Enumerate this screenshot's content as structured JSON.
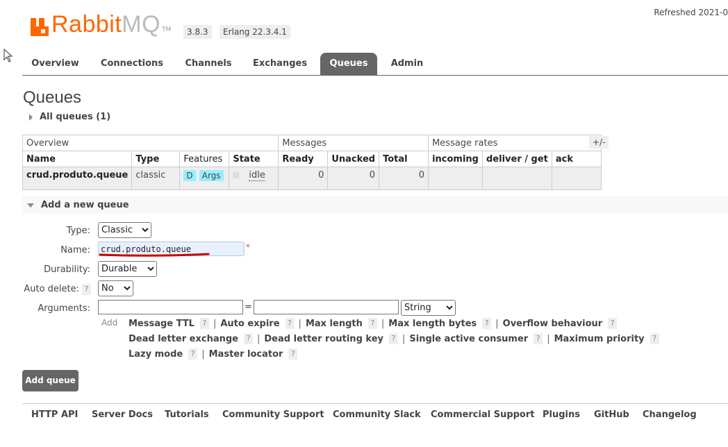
{
  "brand": {
    "name_main": "Rabbit",
    "name_accent": "MQ",
    "tm": "TM"
  },
  "version": "3.8.3",
  "erlang": "Erlang 22.3.4.1",
  "refreshed": "Refreshed 2021-0",
  "tabs": [
    {
      "label": "Overview"
    },
    {
      "label": "Connections"
    },
    {
      "label": "Channels"
    },
    {
      "label": "Exchanges"
    },
    {
      "label": "Queues",
      "active": true
    },
    {
      "label": "Admin"
    }
  ],
  "page_title": "Queues",
  "all_queues_label": "All queues (1)",
  "table": {
    "groups": [
      "Overview",
      "Messages",
      "Message rates"
    ],
    "headers": [
      "Name",
      "Type",
      "Features",
      "State",
      "Ready",
      "Unacked",
      "Total",
      "incoming",
      "deliver / get",
      "ack"
    ],
    "rows": [
      {
        "name": "crud.produto.queue",
        "type": "classic",
        "features": [
          "D",
          "Args"
        ],
        "state": "idle",
        "ready": "0",
        "unacked": "0",
        "total": "0"
      }
    ],
    "plus_minus": "+/-"
  },
  "add_queue": {
    "section_title": "Add a new queue",
    "type_label": "Type:",
    "type_value": "Classic",
    "name_label": "Name:",
    "name_value": "crud.produto.queue",
    "required_mark": "*",
    "durability_label": "Durability:",
    "durability_value": "Durable",
    "auto_delete_label": "Auto delete:",
    "auto_delete_help": "?",
    "auto_delete_value": "No",
    "arguments_label": "Arguments:",
    "equals": "=",
    "arg_type_value": "String",
    "add_label": "Add",
    "arg_links": [
      "Message TTL",
      "Auto expire",
      "Max length",
      "Max length bytes",
      "Overflow behaviour",
      "Dead letter exchange",
      "Dead letter routing key",
      "Single active consumer",
      "Maximum priority",
      "Lazy mode",
      "Master locator"
    ],
    "help": "?",
    "separator": "|",
    "button_label": "Add queue"
  },
  "footer_links": [
    "HTTP API",
    "Server Docs",
    "Tutorials",
    "Community Support",
    "Community Slack",
    "Commercial Support",
    "Plugins",
    "GitHub",
    "Changelog"
  ],
  "colors": {
    "brand_orange": "#ff6600",
    "tab_active": "#666666",
    "feature_chip": "#99eeff",
    "underline_annotation": "#cc0000"
  }
}
